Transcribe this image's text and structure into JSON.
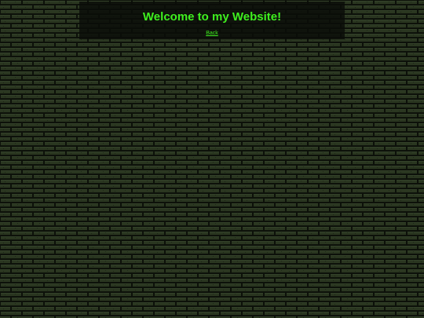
{
  "page": {
    "title": "Welcome to my Website!",
    "back_link_label": "Back"
  },
  "colors": {
    "accent_text": "#3ff01f",
    "brick": "#2a3620",
    "mortar": "#0d110a",
    "panel_background": "#0a0c08"
  },
  "background": {
    "pattern": "dark green brick wall"
  }
}
